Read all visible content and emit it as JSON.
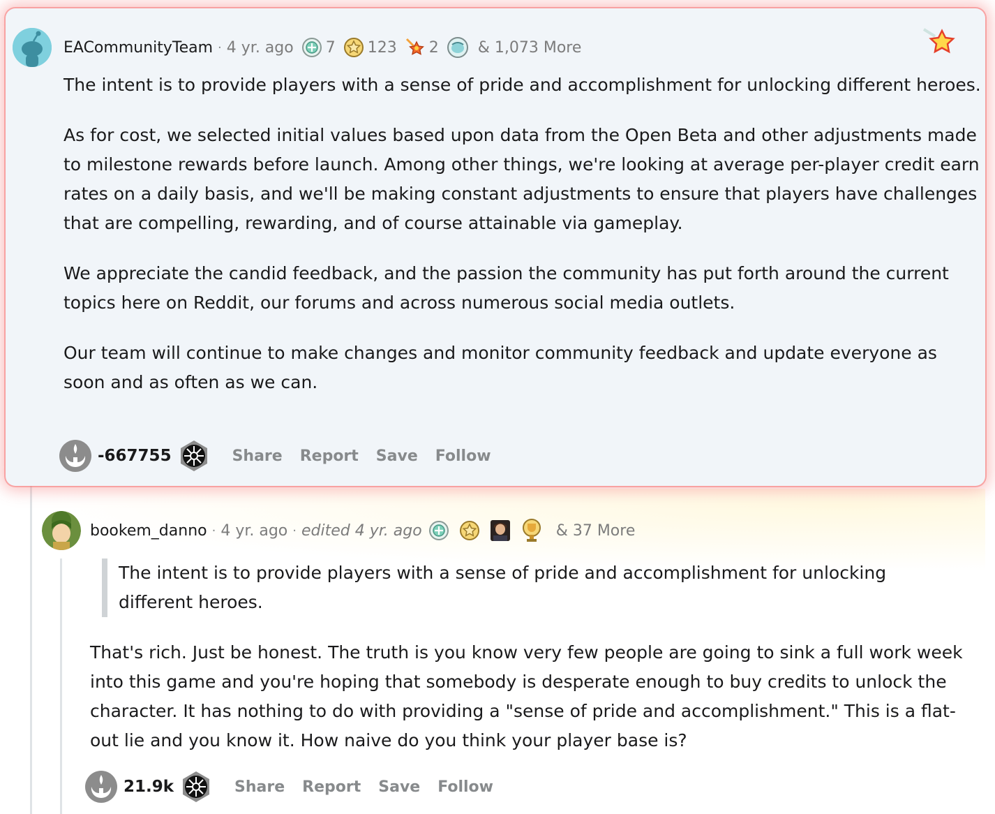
{
  "top_comment": {
    "author": "EACommunityTeam",
    "age": "4 yr. ago",
    "awards": [
      {
        "icon": "helpful-award-icon",
        "count": "7"
      },
      {
        "icon": "wholesome-award-icon",
        "count": "123"
      },
      {
        "icon": "all-seeing-star-award-icon",
        "count": "2"
      },
      {
        "icon": "facepalm-award-icon",
        "count": ""
      }
    ],
    "more_awards": "& 1,073 More",
    "paragraphs": [
      "The intent is to provide players with a sense of pride and accomplishment for unlocking different heroes.",
      "As for cost, we selected initial values based upon data from the Open Beta and other adjustments made to milestone rewards before launch. Among other things, we're looking at average per-player credit earn rates on a daily basis, and we'll be making constant adjustments to ensure that players have challenges that are compelling, rewarding, and of course attainable via gameplay.",
      "We appreciate the candid feedback, and the passion the community has put forth around the current topics here on Reddit, our forums and across numerous social media outlets.",
      "Our team will continue to make changes and monitor community feedback and update everyone as soon and as often as we can."
    ],
    "score": "-667755",
    "actions": {
      "share": "Share",
      "report": "Report",
      "save": "Save",
      "follow": "Follow"
    }
  },
  "reply": {
    "author": "bookem_danno",
    "age": "4 yr. ago",
    "edited": "edited 4 yr. ago",
    "more_awards": "& 37 More",
    "quote": "The intent is to provide players with a sense of pride and accomplishment for unlocking different heroes.",
    "text": "That's rich. Just be honest. The truth is you know very few people are going to sink a full work week into this game and you're hoping that somebody is desperate enough to buy credits to unlock the character. It has nothing to do with providing a \"sense of pride and accomplishment.\" This is a flat-out lie and you know it. How naive do you think your player base is?",
    "score": "21.9k",
    "actions": {
      "share": "Share",
      "report": "Report",
      "save": "Save",
      "follow": "Follow"
    }
  },
  "colors": {
    "card_background": "#f1f5f9",
    "glow": "#f57878",
    "meta_gray": "#7c7c7c",
    "action_gray": "#878a8c"
  }
}
